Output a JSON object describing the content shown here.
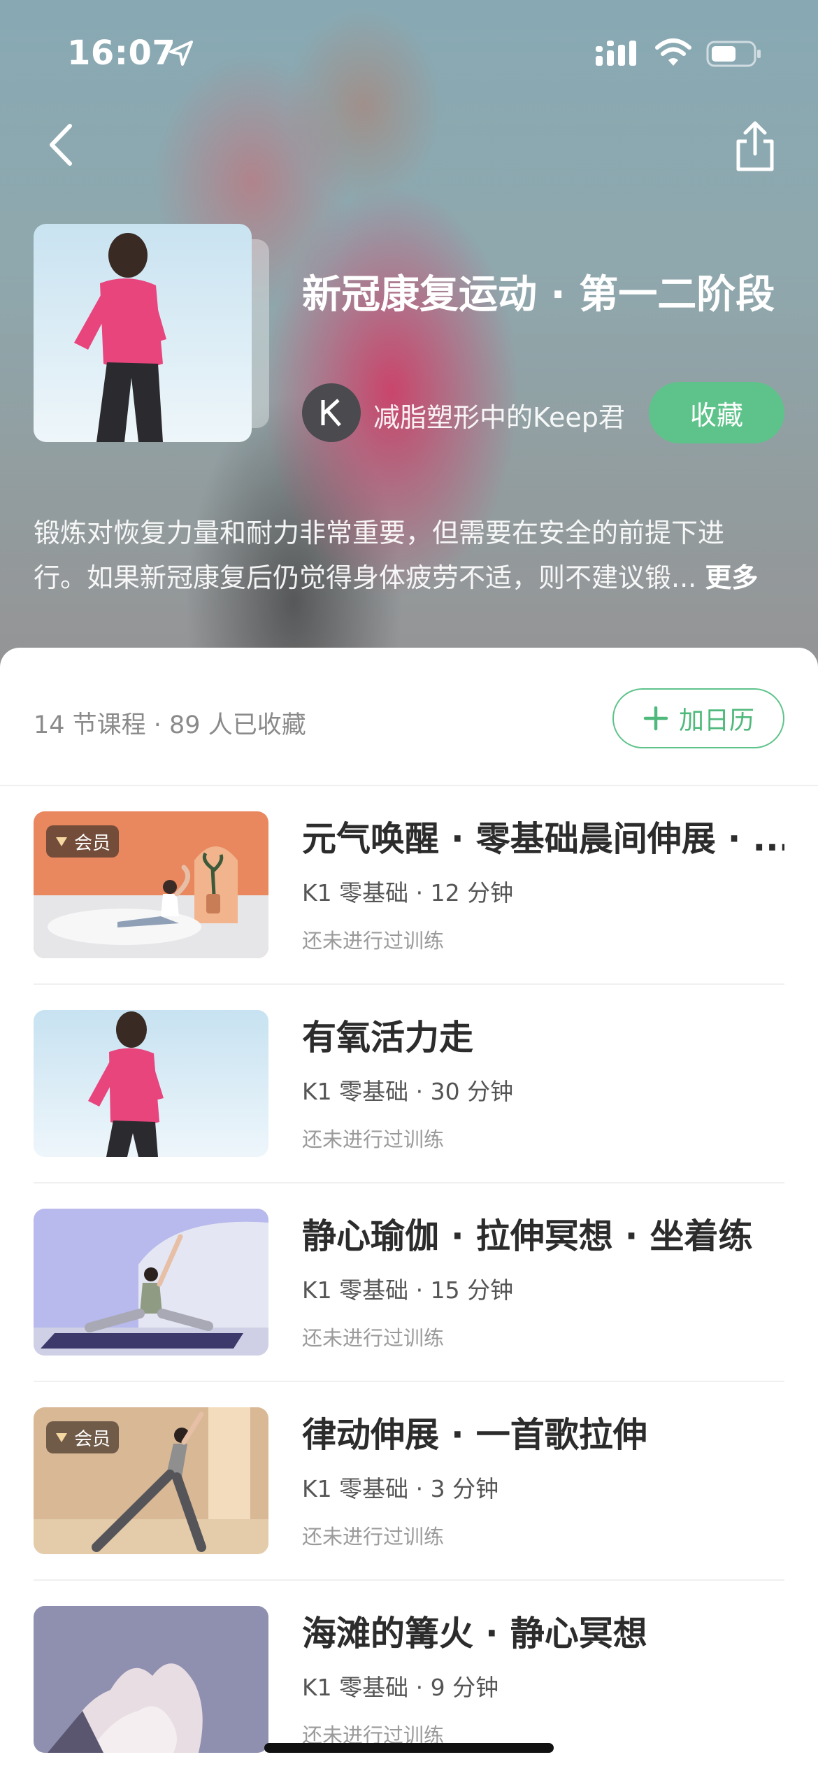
{
  "status_bar": {
    "time": "16:07"
  },
  "header": {
    "title": "新冠康复运动 · 第一二阶段",
    "author": "减脂塑形中的Keep君",
    "author_avatar_letter": "K",
    "collect_label": "收藏",
    "description_line1": "锻炼对恢复力量和耐力非常重要，但需要在安全的前提下进",
    "description_line2": "行。如果新冠康复后仍觉得身体疲劳不适，则不建议锻...",
    "more_label": "更多"
  },
  "summary": {
    "meta": "14 节课程 · 89 人已收藏",
    "calendar_label": "加日历"
  },
  "vip_label": "会员",
  "courses": [
    {
      "title": "元气唤醒 · 零基础晨间伸展 · ...",
      "meta": "K1 零基础 · 12 分钟",
      "status": "还未进行过训练",
      "vip": true
    },
    {
      "title": "有氧活力走",
      "meta": "K1 零基础 · 30 分钟",
      "status": "还未进行过训练",
      "vip": false
    },
    {
      "title": "静心瑜伽 · 拉伸冥想 · 坐着练",
      "meta": "K1 零基础 · 15 分钟",
      "status": "还未进行过训练",
      "vip": false
    },
    {
      "title": "律动伸展 · 一首歌拉伸",
      "meta": "K1 零基础 · 3 分钟",
      "status": "还未进行过训练",
      "vip": true
    },
    {
      "title": "海滩的篝火 · 静心冥想",
      "meta": "K1 零基础 · 9 分钟",
      "status": "还未进行过训练",
      "vip": false
    }
  ],
  "colors": {
    "accent_green": "#5ec38a",
    "accent_green_text": "#4fb97c"
  }
}
